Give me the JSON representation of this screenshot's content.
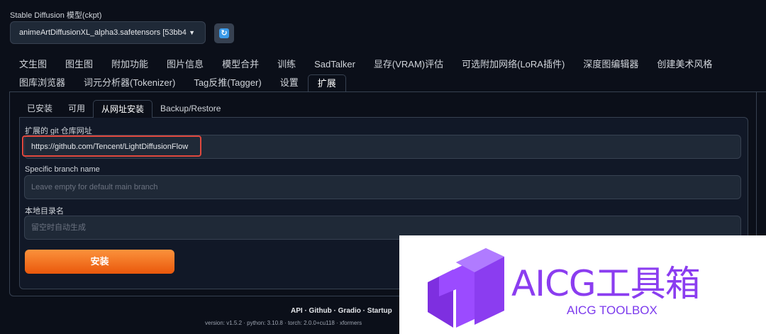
{
  "model": {
    "label": "Stable Diffusion 模型(ckpt)",
    "selected": "animeArtDiffusionXL_alpha3.safetensors [53bb4"
  },
  "tabs_row1": [
    "文生图",
    "图生图",
    "附加功能",
    "图片信息",
    "模型合并",
    "训练",
    "SadTalker",
    "显存(VRAM)评估",
    "可选附加网络(LoRA插件)",
    "深度图编辑器",
    "创建美术风格"
  ],
  "tabs_row2": [
    "图库浏览器",
    "词元分析器(Tokenizer)",
    "Tag反推(Tagger)",
    "设置",
    "扩展"
  ],
  "active_tab": "扩展",
  "subtabs": [
    "已安装",
    "可用",
    "从网址安装",
    "Backup/Restore"
  ],
  "active_subtab": "从网址安装",
  "form": {
    "git_label": "扩展的 git 仓库网址",
    "git_value": "https://github.com/Tencent/LightDiffusionFlow",
    "branch_label": "Specific branch name",
    "branch_placeholder": "Leave empty for default main branch",
    "dir_label": "本地目录名",
    "dir_placeholder": "留空时自动生成",
    "install_label": "安装"
  },
  "footer": {
    "links": "API · Github · Gradio · Startup",
    "versions": "version: v1.5.2 · python: 3.10.8 · torch: 2.0.0+cu118 · xformers"
  },
  "overlay": {
    "title": "AICG工具箱",
    "subtitle": "AICG TOOLBOX",
    "brand_color": "#8b3df0"
  }
}
